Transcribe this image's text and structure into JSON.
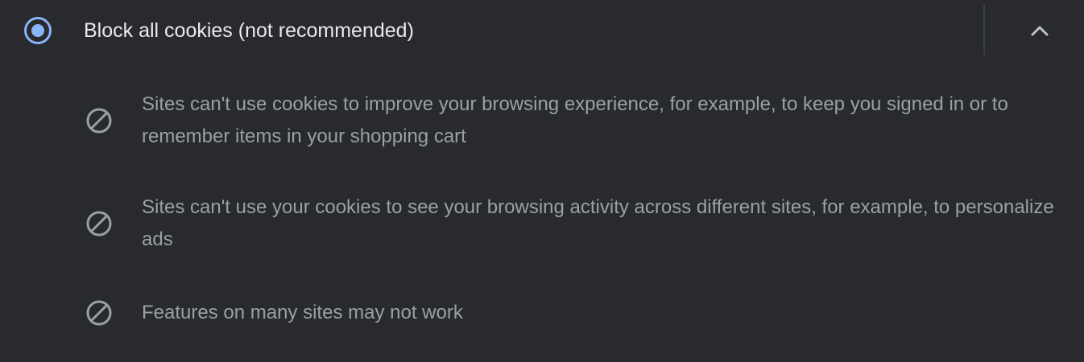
{
  "option": {
    "label": "Block all cookies (not recommended)",
    "selected": true,
    "expanded": true,
    "accent_color": "#8ab4f8"
  },
  "expand_icon": "chevron-up-icon",
  "bullets": [
    {
      "icon": "block-icon",
      "text": "Sites can't use cookies to improve your browsing experience, for example, to keep you signed in or to remember items in your shopping cart"
    },
    {
      "icon": "block-icon",
      "text": "Sites can't use your cookies to see your browsing activity across different sites, for example, to personalize ads"
    },
    {
      "icon": "block-icon",
      "text": "Features on many sites may not work"
    }
  ]
}
